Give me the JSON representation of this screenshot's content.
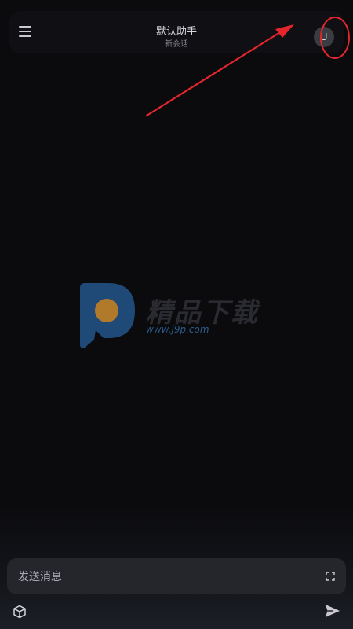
{
  "header": {
    "title": "默认助手",
    "subtitle": "新会话",
    "menu_icon": "hamburger-menu-icon",
    "avatar_initial": "U"
  },
  "watermark": {
    "logo_icon": "site-logo",
    "brand_text": "精品下载",
    "url": "www.j9p.com"
  },
  "composer": {
    "placeholder": "发送消息",
    "expand_icon": "expand-icon",
    "tool_icon": "cube-icon",
    "send_icon": "send-icon"
  },
  "annotation": {
    "color": "#e3262c",
    "target": "avatar"
  },
  "colors": {
    "background": "#0b0b0e",
    "header_bg": "#101014",
    "input_bg": "#25262c",
    "avatar_bg": "#3b3b42"
  }
}
